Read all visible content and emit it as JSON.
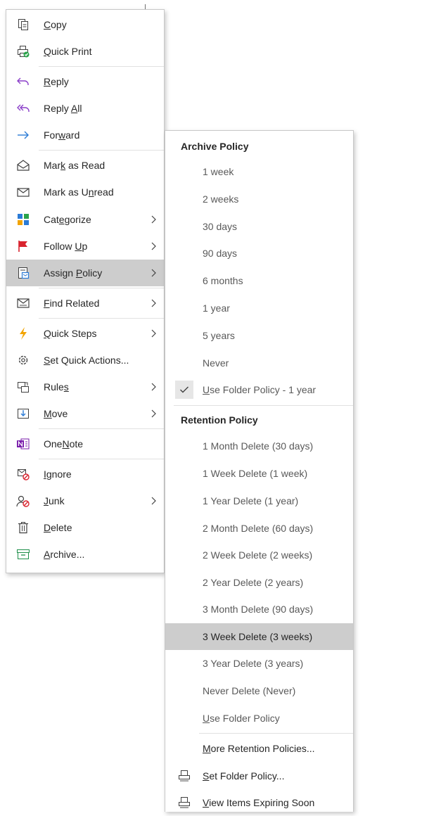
{
  "context_menu": {
    "items": [
      {
        "name": "copy",
        "pre": "",
        "u": "C",
        "post": "opy",
        "has_submenu": false,
        "icon": "copy-icon"
      },
      {
        "name": "quick-print",
        "pre": "",
        "u": "Q",
        "post": "uick Print",
        "has_submenu": false,
        "icon": "quick-print-icon"
      },
      {
        "name": "reply",
        "pre": "",
        "u": "R",
        "post": "eply",
        "has_submenu": false,
        "icon": "reply-icon"
      },
      {
        "name": "reply-all",
        "pre": "Reply ",
        "u": "A",
        "post": "ll",
        "has_submenu": false,
        "icon": "reply-all-icon"
      },
      {
        "name": "forward",
        "pre": "For",
        "u": "w",
        "post": "ard",
        "has_submenu": false,
        "icon": "forward-icon"
      },
      {
        "name": "mark-as-read",
        "pre": "Mar",
        "u": "k",
        "post": " as Read",
        "has_submenu": false,
        "icon": "envelope-open-icon"
      },
      {
        "name": "mark-as-unread",
        "pre": "Mark as U",
        "u": "n",
        "post": "read",
        "has_submenu": false,
        "icon": "envelope-icon"
      },
      {
        "name": "categorize",
        "pre": "Cat",
        "u": "e",
        "post": "gorize",
        "has_submenu": true,
        "icon": "categorize-icon"
      },
      {
        "name": "follow-up",
        "pre": "Follow ",
        "u": "U",
        "post": "p",
        "has_submenu": true,
        "icon": "flag-icon"
      },
      {
        "name": "assign-policy",
        "pre": "Assign ",
        "u": "P",
        "post": "olicy",
        "has_submenu": true,
        "icon": "assign-policy-icon"
      },
      {
        "name": "find-related",
        "pre": "",
        "u": "F",
        "post": "ind Related",
        "has_submenu": true,
        "icon": "find-related-icon"
      },
      {
        "name": "quick-steps",
        "pre": "",
        "u": "Q",
        "post": "uick Steps",
        "has_submenu": true,
        "icon": "lightning-icon"
      },
      {
        "name": "set-quick-actions",
        "pre": "",
        "u": "S",
        "post": "et Quick Actions...",
        "has_submenu": false,
        "icon": "gear-icon"
      },
      {
        "name": "rules",
        "pre": "Rule",
        "u": "s",
        "post": "",
        "has_submenu": true,
        "icon": "rules-icon"
      },
      {
        "name": "move",
        "pre": "",
        "u": "M",
        "post": "ove",
        "has_submenu": true,
        "icon": "move-icon"
      },
      {
        "name": "onenote",
        "pre": "One",
        "u": "N",
        "post": "ote",
        "has_submenu": false,
        "icon": "onenote-icon"
      },
      {
        "name": "ignore",
        "pre": "",
        "u": "I",
        "post": "gnore",
        "has_submenu": false,
        "icon": "ignore-icon"
      },
      {
        "name": "junk",
        "pre": "",
        "u": "J",
        "post": "unk",
        "has_submenu": true,
        "icon": "junk-icon"
      },
      {
        "name": "delete",
        "pre": "",
        "u": "D",
        "post": "elete",
        "has_submenu": false,
        "icon": "trash-icon"
      },
      {
        "name": "archive",
        "pre": "",
        "u": "A",
        "post": "rchive...",
        "has_submenu": false,
        "icon": "archive-icon"
      }
    ],
    "highlighted": "Assign Policy"
  },
  "submenu": {
    "archive_header": "Archive Policy",
    "archive_items": [
      {
        "text": "1 week"
      },
      {
        "text": "2 weeks"
      },
      {
        "text": "30 days"
      },
      {
        "text": "90 days"
      },
      {
        "text": "6 months"
      },
      {
        "text": "1 year"
      },
      {
        "text": "5 years"
      },
      {
        "text": "Never"
      }
    ],
    "folder_policy": {
      "u": "U",
      "post": "se Folder Policy - 1 year",
      "checked": true,
      "icon": "checkmark-icon"
    },
    "retention_header": "Retention Policy",
    "retention_items": [
      {
        "text": "1 Month Delete (30 days)"
      },
      {
        "text": "1 Week Delete (1 week)"
      },
      {
        "text": "1 Year Delete (1 year)"
      },
      {
        "text": "2 Month Delete (60 days)"
      },
      {
        "text": "2 Week Delete (2 weeks)"
      },
      {
        "text": "2 Year Delete (2 years)"
      },
      {
        "text": "3 Month Delete (90 days)"
      },
      {
        "text": "3 Week Delete (3 weeks)"
      },
      {
        "text": "3 Year Delete (3 years)"
      },
      {
        "text": "Never Delete (Never)"
      }
    ],
    "use_folder_policy": {
      "u": "U",
      "post": "se Folder Policy"
    },
    "more_retention": {
      "pre": "",
      "u": "M",
      "post": "ore Retention Policies..."
    },
    "set_folder_policy": {
      "u": "S",
      "post": "et Folder Policy...",
      "icon": "printer-policy-icon"
    },
    "view_expiring": {
      "u": "V",
      "post": "iew Items Expiring Soon",
      "icon": "printer-policy-icon"
    },
    "highlighted": "3 Week Delete (3 weeks)"
  },
  "colors": {
    "highlight": "#cdcdcd",
    "accent_blue": "#2b7bd6",
    "onenote_purple": "#7719aa",
    "reply_all_purple": "#8b3fc9",
    "follow_up_red": "#d9232e",
    "quick_steps_orange": "#f2a400",
    "ignore_red": "#d9232e",
    "archive_green": "#1e8f4a"
  }
}
